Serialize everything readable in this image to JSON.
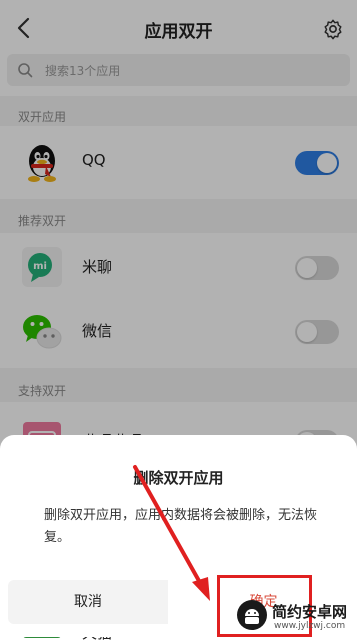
{
  "header": {
    "title": "应用双开"
  },
  "search": {
    "placeholder": "搜索13个应用"
  },
  "sections": {
    "dual": "双开应用",
    "recommended": "推荐双开",
    "supported": "支持双开"
  },
  "apps": {
    "qq": {
      "name": "QQ",
      "enabled": true
    },
    "miliao": {
      "name": "米聊",
      "enabled": false
    },
    "wechat": {
      "name": "微信",
      "enabled": false
    },
    "bilibili": {
      "name": "哔哩哔哩",
      "enabled": false
    }
  },
  "partial_row_label": "天猫",
  "dialog": {
    "title": "删除双开应用",
    "message": "删除双开应用，应用内数据将会被删除，无法恢复。",
    "cancel": "取消",
    "confirm": "确定"
  },
  "watermark": {
    "name": "简约安卓网",
    "url": "www.jylzwj.com"
  },
  "colors": {
    "accent": "#2f7fe6",
    "highlight": "#e02020"
  }
}
